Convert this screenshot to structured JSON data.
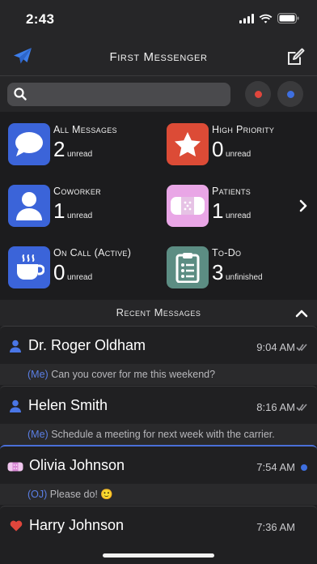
{
  "status": {
    "time": "2:43"
  },
  "nav": {
    "title": "First Messenger"
  },
  "search": {
    "placeholder": "",
    "filter_red": "#e0463c",
    "filter_blue": "#3e6fe0"
  },
  "categories": [
    {
      "name": "All Messages",
      "count": "2",
      "sub": "unread",
      "icon": "chat-bubble-icon",
      "color": "#3b64d9"
    },
    {
      "name": "High Priority",
      "count": "0",
      "sub": "unread",
      "icon": "star-icon",
      "color": "#dc4b36"
    },
    {
      "name": "Coworker",
      "count": "1",
      "sub": "unread",
      "icon": "person-icon",
      "color": "#3b64d9"
    },
    {
      "name": "Patients",
      "count": "1",
      "sub": "unread",
      "icon": "bandage-icon",
      "color": "#e9a6e6"
    },
    {
      "name": "On Call (Active)",
      "count": "0",
      "sub": "unread",
      "icon": "coffee-icon",
      "color": "#3b64d9"
    },
    {
      "name": "To-Do",
      "count": "3",
      "sub": "unfinished",
      "icon": "clipboard-icon",
      "color": "#5c8d83"
    }
  ],
  "recent": {
    "title": "Recent Messages",
    "messages": [
      {
        "name": "Dr. Roger Oldham",
        "time": "9:04 AM",
        "who": "(Me)",
        "text": "Can you cover for me this weekend?",
        "icon": "person-icon",
        "status": "read-checkmarks-icon"
      },
      {
        "name": "Helen Smith",
        "time": "8:16 AM",
        "who": "(Me)",
        "text": "Schedule a meeting for next week with the carrier.",
        "icon": "person-icon",
        "status": "read-checkmarks-icon"
      },
      {
        "name": "Olivia Johnson",
        "time": "7:54 AM",
        "who": "(OJ)",
        "text": "Please do! 🙂",
        "icon": "bandage-icon",
        "status": "unread-dot"
      },
      {
        "name": "Harry Johnson",
        "time": "7:36 AM",
        "who": "",
        "text": "",
        "icon": "heart-icon",
        "status": ""
      }
    ]
  }
}
